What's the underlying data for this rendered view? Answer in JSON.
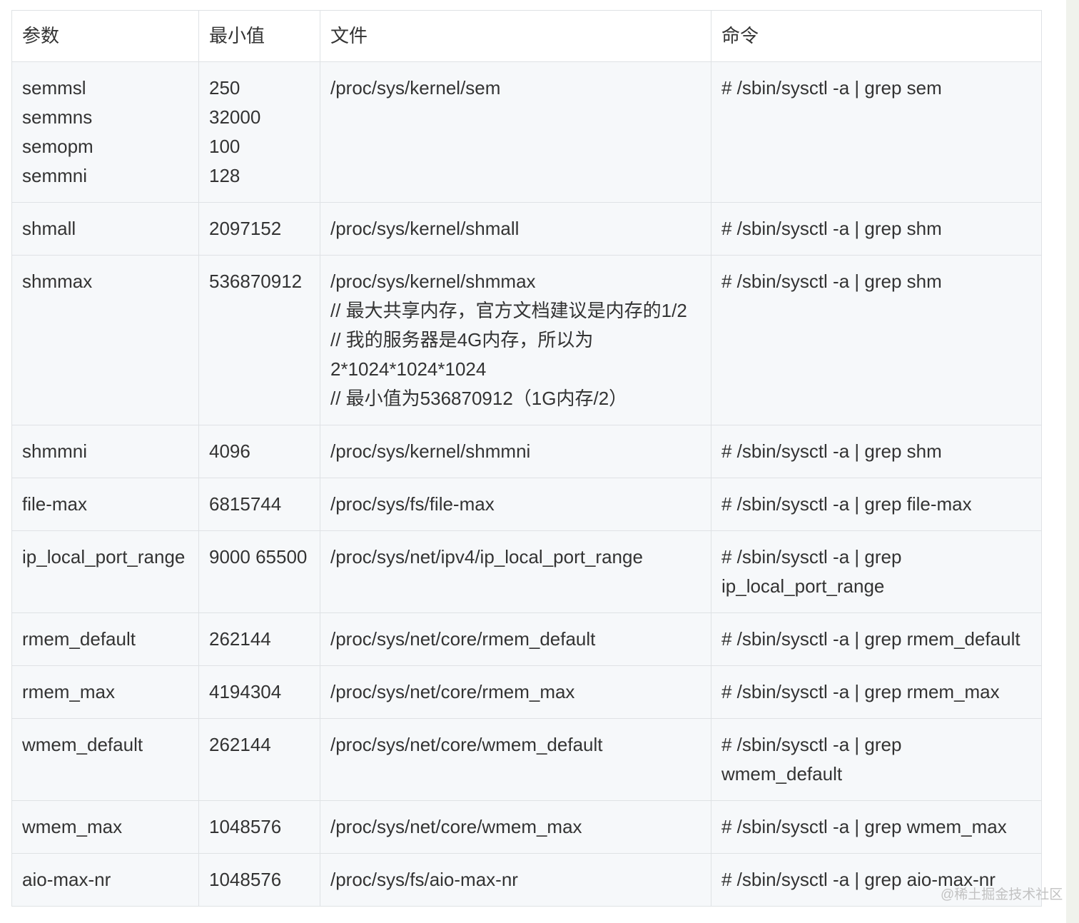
{
  "table": {
    "headers": [
      "参数",
      "最小值",
      "文件",
      "命令"
    ],
    "rows": [
      {
        "param": [
          "semmsl",
          "semmns",
          "semopm",
          "semmni"
        ],
        "min": [
          "250",
          "32000",
          "100",
          "128"
        ],
        "file": [
          "/proc/sys/kernel/sem"
        ],
        "cmd": [
          "# /sbin/sysctl -a | grep sem"
        ]
      },
      {
        "param": [
          "shmall"
        ],
        "min": [
          "2097152"
        ],
        "file": [
          "/proc/sys/kernel/shmall"
        ],
        "cmd": [
          "# /sbin/sysctl -a | grep shm"
        ]
      },
      {
        "param": [
          "shmmax"
        ],
        "min": [
          "536870912"
        ],
        "file": [
          "/proc/sys/kernel/shmmax",
          "// 最大共享内存，官方文档建议是内存的1/2",
          "// 我的服务器是4G内存，所以为",
          "2*1024*1024*1024",
          "// 最小值为536870912（1G内存/2）"
        ],
        "cmd": [
          "# /sbin/sysctl -a | grep shm"
        ]
      },
      {
        "param": [
          "shmmni"
        ],
        "min": [
          "4096"
        ],
        "file": [
          "/proc/sys/kernel/shmmni"
        ],
        "cmd": [
          "# /sbin/sysctl -a | grep shm"
        ]
      },
      {
        "param": [
          "file-max"
        ],
        "min": [
          "6815744"
        ],
        "file": [
          "/proc/sys/fs/file-max"
        ],
        "cmd": [
          "# /sbin/sysctl -a | grep file-max"
        ]
      },
      {
        "param": [
          "ip_local_port_range"
        ],
        "min": [
          "9000 65500"
        ],
        "file": [
          "/proc/sys/net/ipv4/ip_local_port_range"
        ],
        "cmd": [
          "# /sbin/sysctl -a | grep",
          "ip_local_port_range"
        ]
      },
      {
        "param": [
          "rmem_default"
        ],
        "min": [
          "262144"
        ],
        "file": [
          "/proc/sys/net/core/rmem_default"
        ],
        "cmd": [
          "# /sbin/sysctl -a | grep rmem_default"
        ]
      },
      {
        "param": [
          "rmem_max"
        ],
        "min": [
          "4194304"
        ],
        "file": [
          "/proc/sys/net/core/rmem_max"
        ],
        "cmd": [
          "# /sbin/sysctl -a | grep rmem_max"
        ]
      },
      {
        "param": [
          "wmem_default"
        ],
        "min": [
          "262144"
        ],
        "file": [
          "/proc/sys/net/core/wmem_default"
        ],
        "cmd": [
          "# /sbin/sysctl -a | grep",
          "wmem_default"
        ]
      },
      {
        "param": [
          "wmem_max"
        ],
        "min": [
          "1048576"
        ],
        "file": [
          "/proc/sys/net/core/wmem_max"
        ],
        "cmd": [
          "# /sbin/sysctl -a | grep wmem_max"
        ]
      },
      {
        "param": [
          "aio-max-nr"
        ],
        "min": [
          "1048576"
        ],
        "file": [
          "/proc/sys/fs/aio-max-nr"
        ],
        "cmd": [
          "# /sbin/sysctl -a | grep aio-max-nr"
        ]
      }
    ]
  },
  "watermark": "@稀土掘金技术社区",
  "colors": {
    "border": "#dfe2e5",
    "row_background": "#f6f8fa",
    "header_background": "#ffffff",
    "text": "#333333",
    "watermark": "#c2c2c2"
  }
}
